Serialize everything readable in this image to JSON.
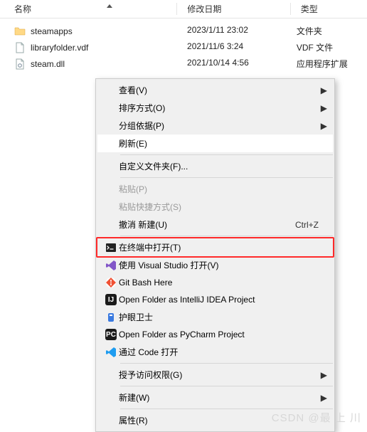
{
  "header": {
    "name": "名称",
    "date": "修改日期",
    "type": "类型"
  },
  "files": [
    {
      "icon": "folder",
      "name": "steamapps",
      "date": "2023/1/11 23:02",
      "type": "文件夹"
    },
    {
      "icon": "file",
      "name": "libraryfolder.vdf",
      "date": "2021/11/6 3:24",
      "type": "VDF 文件"
    },
    {
      "icon": "file",
      "name": "steam.dll",
      "date": "2021/10/14 4:56",
      "type": "应用程序扩展"
    }
  ],
  "menu": {
    "view": "查看(V)",
    "sort": "排序方式(O)",
    "group": "分组依据(P)",
    "refresh": "刷新(E)",
    "customize": "自定义文件夹(F)...",
    "paste": "粘贴(P)",
    "paste_shortcut": "粘贴快捷方式(S)",
    "undo_new": "撤消 新建(U)",
    "undo_shortcut": "Ctrl+Z",
    "open_terminal": "在终端中打开(T)",
    "open_vs": "使用 Visual Studio 打开(V)",
    "git_bash": "Git Bash Here",
    "intellij": "Open Folder as IntelliJ IDEA Project",
    "huyan": "护眼卫士",
    "pycharm": "Open Folder as PyCharm Project",
    "vscode": "通过 Code 打开",
    "grant_access": "授予访问权限(G)",
    "new": "新建(W)",
    "properties": "属性(R)"
  },
  "watermark": "CSDN @最 上 川"
}
